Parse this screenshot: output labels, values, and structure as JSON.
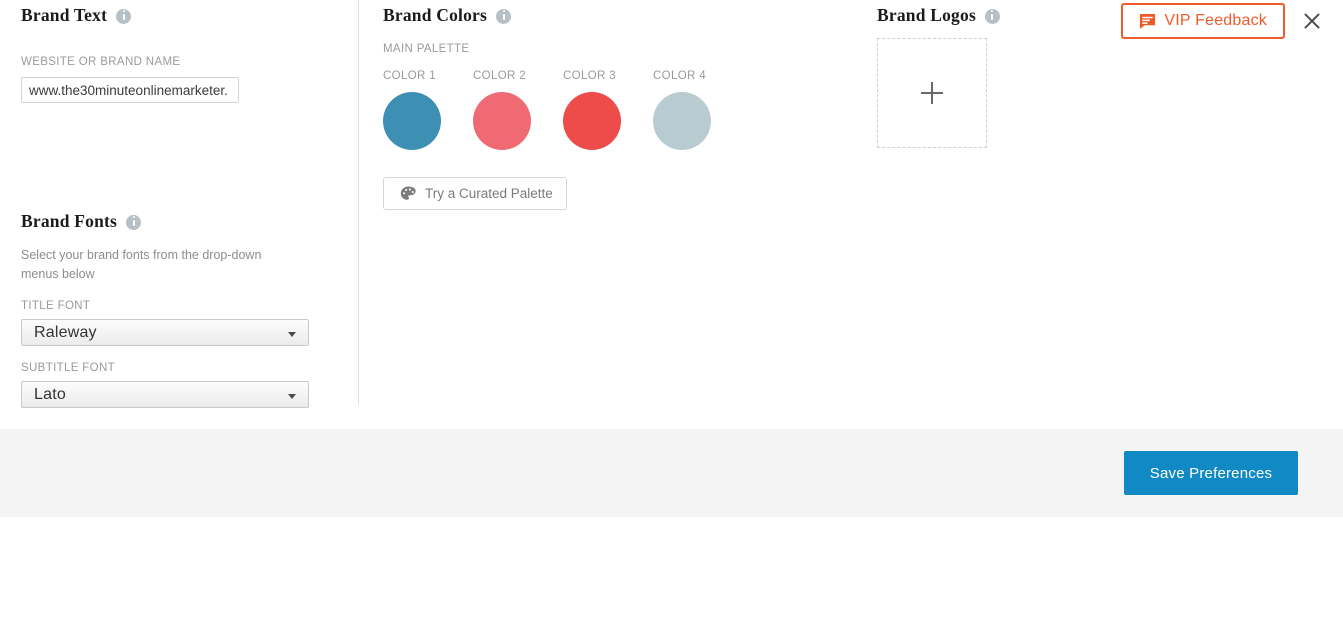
{
  "brand_text": {
    "title": "Brand Text",
    "info_icon": "info-icon",
    "field_label": "WEBSITE OR BRAND NAME",
    "value": "www.the30minuteonlinemarketer.",
    "placeholder": "www.the30minuteonlinemarketer."
  },
  "brand_fonts": {
    "title": "Brand Fonts",
    "info_icon": "info-icon",
    "description": "Select your brand fonts from the drop-down menus below",
    "title_font": {
      "label": "TITLE FONT",
      "value": "Raleway",
      "caret_icon": "chevron-down-icon"
    },
    "subtitle_font": {
      "label": "SUBTITLE FONT",
      "value": "Lato",
      "caret_icon": "chevron-down-icon"
    }
  },
  "brand_colors": {
    "title": "Brand Colors",
    "info_icon": "info-icon",
    "palette_label": "MAIN PALETTE",
    "swatches": [
      {
        "label": "COLOR 1",
        "color": "#3d8fb3"
      },
      {
        "label": "COLOR 2",
        "color": "#f06a73"
      },
      {
        "label": "COLOR 3",
        "color": "#ee4b4b"
      },
      {
        "label": "COLOR 4",
        "color": "#b8cbd0"
      }
    ],
    "curated_button": {
      "label": "Try a Curated Palette",
      "icon": "palette-icon"
    }
  },
  "brand_logos": {
    "title": "Brand Logos",
    "info_icon": "info-icon",
    "add_icon": "plus-icon"
  },
  "feedback": {
    "label": "VIP Feedback",
    "icon": "comment-icon",
    "accent_color": "#ef5a2a",
    "close_icon": "close-icon"
  },
  "footer": {
    "save_label": "Save Preferences",
    "save_color": "#1089c5"
  }
}
